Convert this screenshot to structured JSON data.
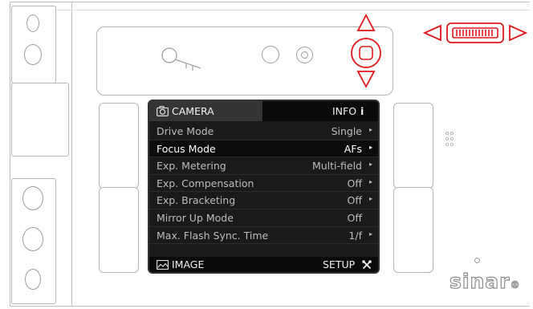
{
  "screen": {
    "header": {
      "left_tab": "CAMERA",
      "right_tab": "INFO",
      "info_glyph": "i"
    },
    "menu": [
      {
        "label": "Drive Mode",
        "value": "Single",
        "arrow": "▸"
      },
      {
        "label": "Focus Mode",
        "value": "AFs",
        "arrow": "▸",
        "selected": true
      },
      {
        "label": "Exp. Metering",
        "value": "Multi-field",
        "arrow": "▸"
      },
      {
        "label": "Exp. Compensation",
        "value": "Off",
        "arrow": "▸"
      },
      {
        "label": "Exp. Bracketing",
        "value": "Off",
        "arrow": "▸"
      },
      {
        "label": "Mirror Up Mode",
        "value": "Off",
        "arrow": ""
      },
      {
        "label": "Max. Flash Sync. Time",
        "value": "1/f",
        "arrow": "▸"
      }
    ],
    "footer": {
      "left_tab": "IMAGE",
      "right_tab": "SETUP"
    }
  },
  "brand": {
    "text": "sinar",
    "mark": "®"
  },
  "icons": {
    "header_left": "camera-icon",
    "footer_left": "image-icon",
    "footer_right": "tools-icon",
    "key": "key-icon",
    "dpad_up": "arrow-up-icon",
    "dpad_down": "arrow-down-icon",
    "wheel_left": "arrow-left-icon",
    "wheel_right": "arrow-right-icon"
  },
  "colors": {
    "highlight": "#e3161b",
    "screen_bg": "#1a1a1a",
    "body_line": "#bdbdbd"
  }
}
